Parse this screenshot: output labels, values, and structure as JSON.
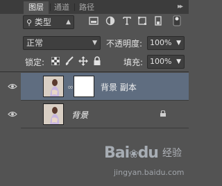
{
  "tabs": [
    {
      "label": "图层",
      "active": true
    },
    {
      "label": "通道",
      "active": false
    },
    {
      "label": "路径",
      "active": false
    }
  ],
  "filter": {
    "kind_label": "类型"
  },
  "filter_icons": [
    "image-filter-icon",
    "adjustment-filter-icon",
    "type-filter-icon",
    "shape-filter-icon",
    "smart-object-filter-icon"
  ],
  "blend": {
    "mode": "正常",
    "opacity_label": "不透明度:",
    "opacity_value": "100%"
  },
  "lock": {
    "label": "锁定:",
    "fill_label": "填充:",
    "fill_value": "100%"
  },
  "layers": [
    {
      "name": "背景 副本",
      "selected": true,
      "has_mask": true,
      "locked": false
    },
    {
      "name": "背景",
      "selected": false,
      "has_mask": false,
      "locked": true
    }
  ],
  "watermark": {
    "brand": "Bai",
    "brand_suffix": "du",
    "cn": "经验",
    "url": "jingyan.baidu.com"
  },
  "colors": {
    "panel": "#535353",
    "tabbar": "#3c3c3c",
    "selected_row": "#5f6d80"
  }
}
